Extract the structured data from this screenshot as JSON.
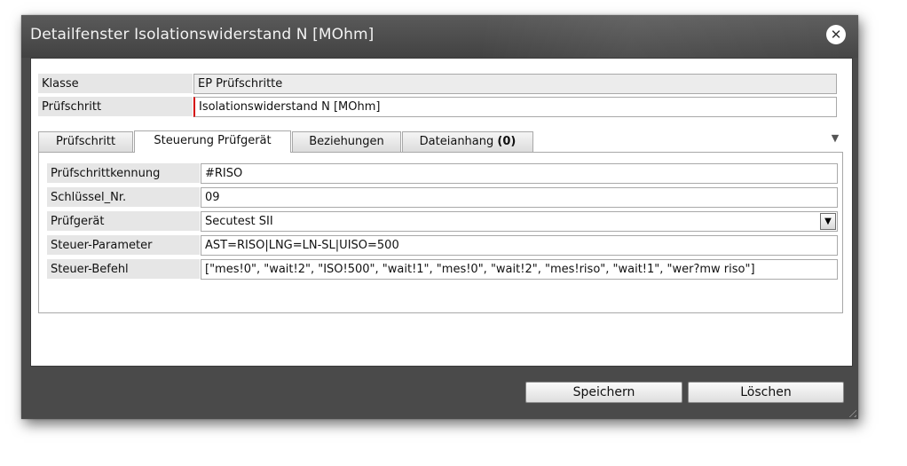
{
  "window": {
    "title": "Detailfenster Isolationswiderstand N [MOhm]",
    "close_icon": "close-icon"
  },
  "header_fields": [
    {
      "label": "Klasse",
      "value": "EP Prüfschritte"
    },
    {
      "label": "Prüfschritt",
      "value": "Isolationswiderstand N [MOhm]"
    }
  ],
  "tabs": [
    {
      "label": "Prüfschritt",
      "count": ""
    },
    {
      "label": "Steuerung Prüfgerät",
      "count": ""
    },
    {
      "label": "Beziehungen",
      "count": ""
    },
    {
      "label": "Dateianhang ",
      "count": "(0)"
    }
  ],
  "active_tab": "Steuerung Prüfgerät",
  "steuerung": [
    {
      "label": "Prüfschrittkennung",
      "value": "#RISO"
    },
    {
      "label": "Schlüssel_Nr.",
      "value": "09"
    },
    {
      "label": "Prüfgerät",
      "value": "Secutest SII"
    },
    {
      "label": "Steuer-Parameter",
      "value": "AST=RISO|LNG=LN-SL|UISO=500"
    },
    {
      "label": "Steuer-Befehl",
      "value": "[\"mes!0\", \"wait!2\", \"ISO!500\", \"wait!1\", \"mes!0\", \"wait!2\", \"mes!riso\", \"wait!1\", \"wer?mw riso\"]"
    }
  ],
  "buttons": {
    "save": "Speichern",
    "delete": "Löschen"
  },
  "colors": {
    "required_marker": "#d40000",
    "titlebar": "#4a4a4a"
  }
}
